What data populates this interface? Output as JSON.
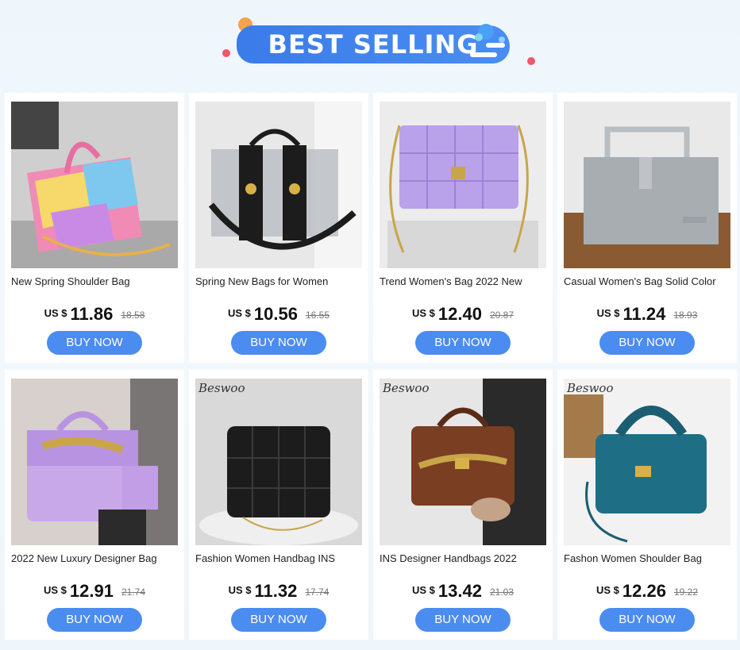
{
  "header": {
    "title": "BEST SELLING"
  },
  "colors": {
    "accent": "#4b8cf0",
    "banner": "#3b7bea"
  },
  "products": [
    {
      "name": "New Spring Shoulder Bag",
      "currency": "US $",
      "price": "11.86",
      "old_price": "18.58",
      "button": "BUY NOW",
      "brand": "",
      "img": "tiedye"
    },
    {
      "name": "Spring New Bags for Women",
      "currency": "US $",
      "price": "10.56",
      "old_price": "16.55",
      "button": "BUY NOW",
      "brand": "",
      "img": "clear"
    },
    {
      "name": "Trend Women's Bag 2022 New",
      "currency": "US $",
      "price": "12.40",
      "old_price": "20.87",
      "button": "BUY NOW",
      "brand": "",
      "img": "purple"
    },
    {
      "name": "Casual Women's Bag Solid Color",
      "currency": "US $",
      "price": "11.24",
      "old_price": "18.93",
      "button": "BUY NOW",
      "brand": "",
      "img": "grey"
    },
    {
      "name": "2022 New Luxury Designer Bag",
      "currency": "US $",
      "price": "12.91",
      "old_price": "21.74",
      "button": "BUY NOW",
      "brand": "",
      "img": "lilac"
    },
    {
      "name": "Fashion Women Handbag INS",
      "currency": "US $",
      "price": "11.32",
      "old_price": "17.74",
      "button": "BUY NOW",
      "brand": "Beswoo",
      "img": "black"
    },
    {
      "name": "INS Designer Handbags 2022",
      "currency": "US $",
      "price": "13.42",
      "old_price": "21.03",
      "button": "BUY NOW",
      "brand": "Beswoo",
      "img": "brown"
    },
    {
      "name": "Fashon Women Shoulder Bag",
      "currency": "US $",
      "price": "12.26",
      "old_price": "19.22",
      "button": "BUY NOW",
      "brand": "Beswoo",
      "img": "teal"
    }
  ]
}
